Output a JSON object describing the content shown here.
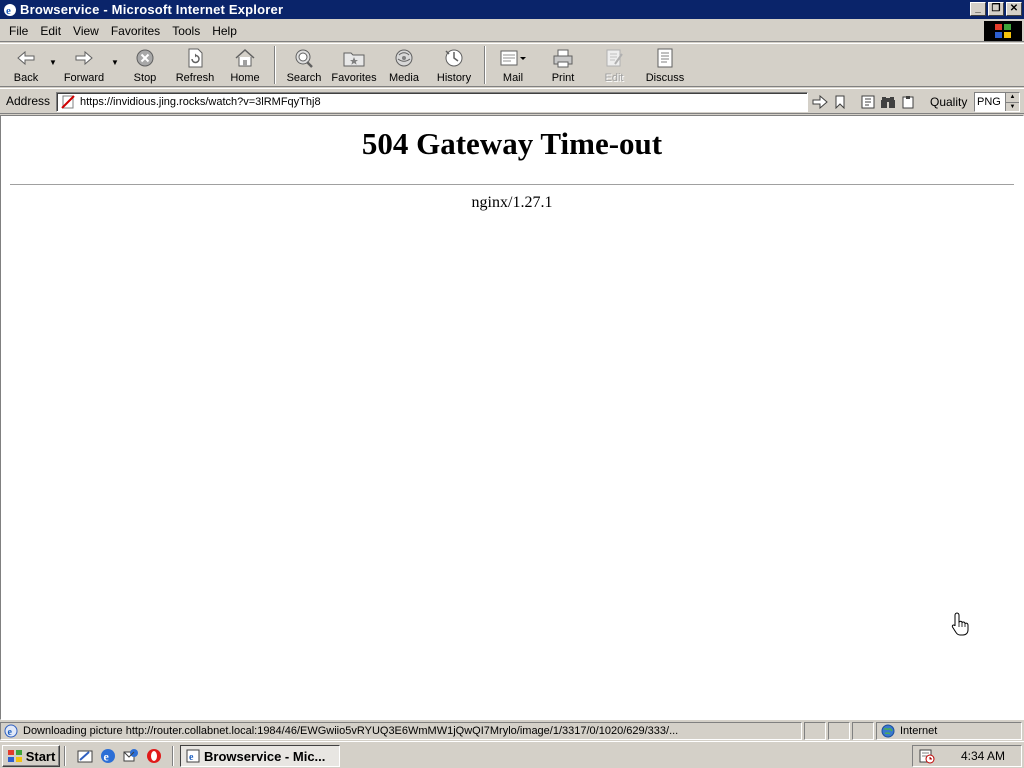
{
  "window": {
    "title": "Browservice - Microsoft Internet Explorer",
    "controls": [
      "_",
      "❐",
      "✕"
    ]
  },
  "menu": {
    "items": [
      "File",
      "Edit",
      "View",
      "Favorites",
      "Tools",
      "Help"
    ]
  },
  "toolbar": {
    "buttons": [
      {
        "label": "Back",
        "icon": "back-arrow-icon"
      },
      {
        "label": "Forward",
        "icon": "forward-arrow-icon"
      },
      {
        "label": "Stop",
        "icon": "stop-icon"
      },
      {
        "label": "Refresh",
        "icon": "refresh-icon"
      },
      {
        "label": "Home",
        "icon": "home-icon"
      },
      {
        "label": "Search",
        "icon": "search-icon"
      },
      {
        "label": "Favorites",
        "icon": "favorites-icon"
      },
      {
        "label": "Media",
        "icon": "media-icon"
      },
      {
        "label": "History",
        "icon": "history-icon"
      },
      {
        "label": "Mail",
        "icon": "mail-icon"
      },
      {
        "label": "Print",
        "icon": "print-icon"
      },
      {
        "label": "Edit",
        "icon": "edit-icon"
      },
      {
        "label": "Discuss",
        "icon": "discuss-icon"
      }
    ]
  },
  "address": {
    "label": "Address",
    "url": "https://invidious.jing.rocks/watch?v=3lRMFqyThj8",
    "quality_label": "Quality",
    "quality_value": "PNG"
  },
  "page": {
    "heading": "504 Gateway Time-out",
    "server": "nginx/1.27.1"
  },
  "status": {
    "text": "Downloading picture http://router.collabnet.local:1984/46/EWGwiio5vRYUQ3E6WmMW1jQwQI7Mrylo/image/1/3317/0/1020/629/333/...",
    "zone": "Internet"
  },
  "taskbar": {
    "start_label": "Start",
    "task_label": "Browservice - Mic...",
    "clock": "4:34 AM"
  },
  "colors": {
    "titlebar": "#0a246a",
    "chrome": "#d4d0c8"
  }
}
